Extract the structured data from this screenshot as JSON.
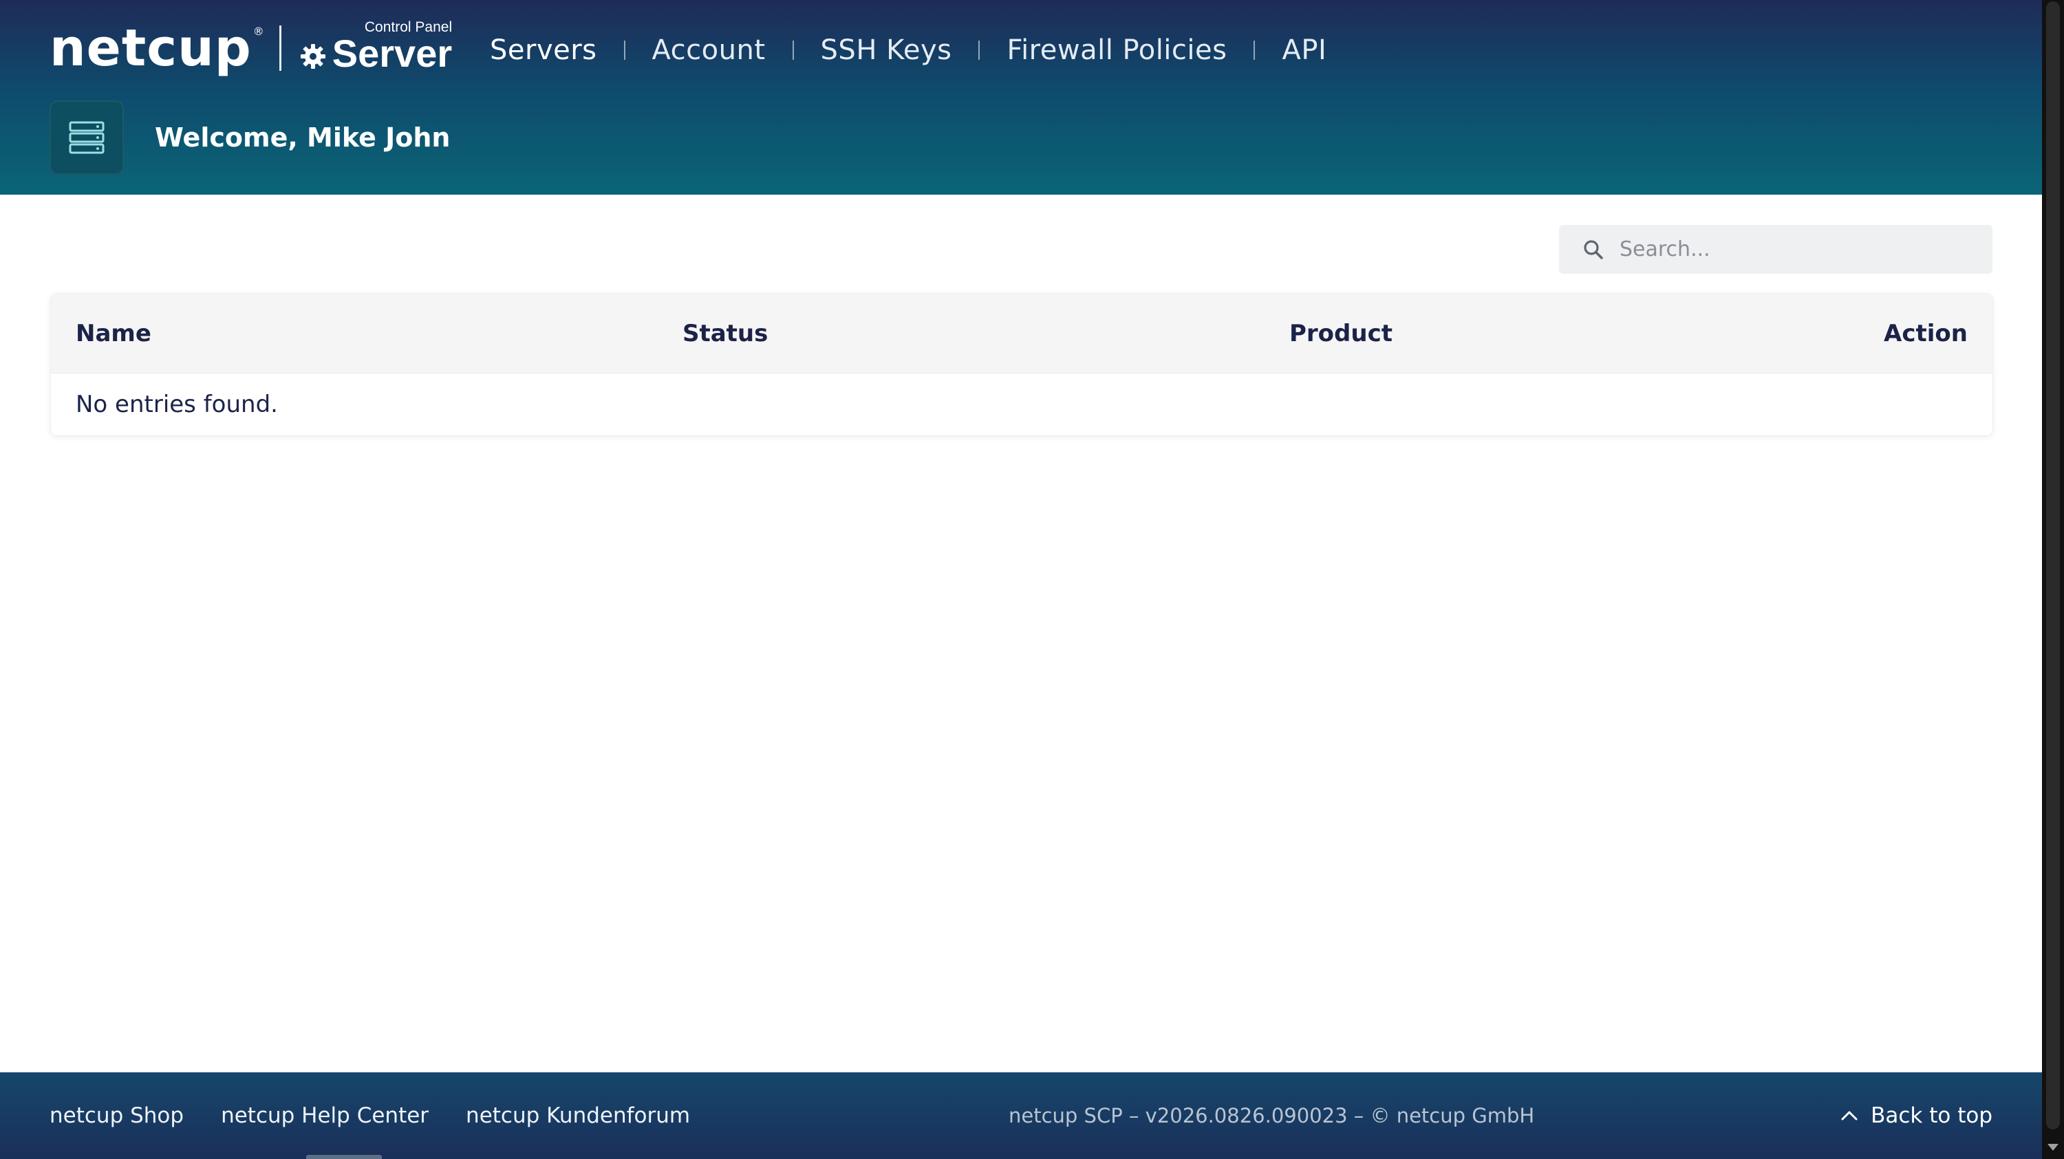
{
  "header": {
    "brand": {
      "name": "netcup",
      "registered": "®",
      "product_small": "Control Panel",
      "product_big": "Server"
    },
    "nav": {
      "items": [
        {
          "label": "Servers",
          "active": true
        },
        {
          "label": "Account",
          "active": false
        },
        {
          "label": "SSH Keys",
          "active": false
        },
        {
          "label": "Firewall Policies",
          "active": false
        },
        {
          "label": "API",
          "active": false
        }
      ]
    },
    "welcome": "Welcome, Mike John",
    "icons": {
      "server": "server-stack-icon",
      "gear": "gear-icon"
    }
  },
  "main": {
    "search": {
      "placeholder": "Search...",
      "value": "",
      "icon": "search-icon"
    },
    "table": {
      "columns": [
        "Name",
        "Status",
        "Product",
        "Action"
      ],
      "rows": [],
      "empty_message": "No entries found."
    }
  },
  "footer": {
    "links": [
      "netcup Shop",
      "netcup Help Center",
      "netcup Kundenforum"
    ],
    "version": "netcup SCP – v2026.0826.090023 – © netcup GmbH",
    "back_to_top": "Back to top"
  },
  "colors": {
    "header_top": "#1f2b58",
    "header_bottom": "#0a6577",
    "heading_text": "#1c2348",
    "footer_bg": "#1a2f5a"
  }
}
